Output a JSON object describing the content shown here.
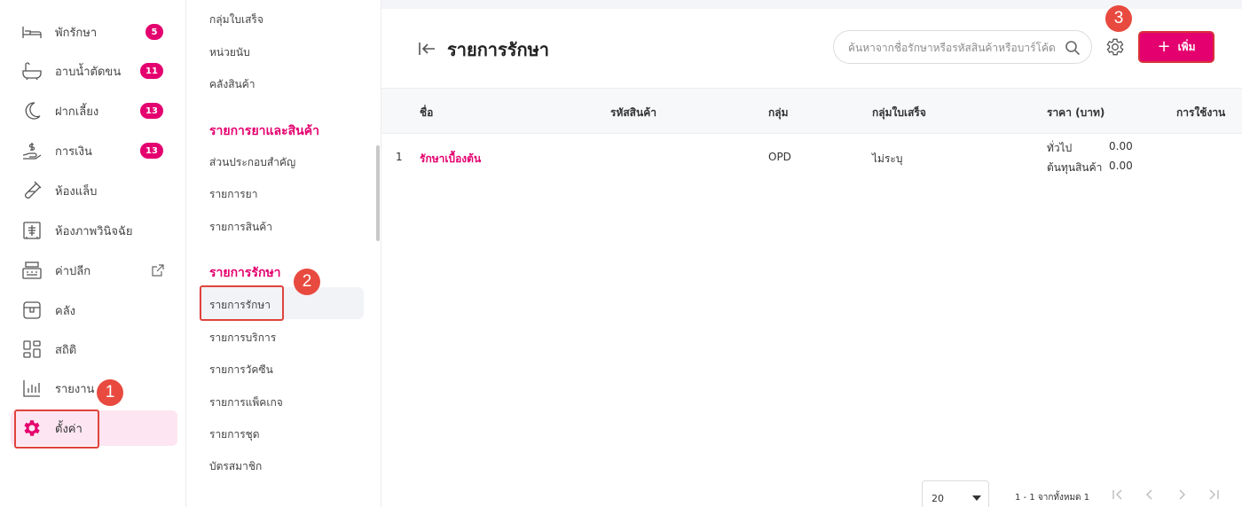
{
  "sidebar": {
    "items": [
      {
        "label": "พักรักษา",
        "badge": "5"
      },
      {
        "label": "อาบน้ำตัดขน",
        "badge": "11"
      },
      {
        "label": "ฝากเลี้ยง",
        "badge": "13"
      },
      {
        "label": "การเงิน",
        "badge": "13"
      },
      {
        "label": "ห้องแล็บ"
      },
      {
        "label": "ห้องภาพวินิจฉัย"
      },
      {
        "label": "ค่าปลีก"
      },
      {
        "label": "คลัง"
      },
      {
        "label": "สถิติ"
      },
      {
        "label": "รายงาน"
      },
      {
        "label": "ตั้งค่า"
      }
    ]
  },
  "submenu": {
    "items_top": [
      "กลุ่มใบเสร็จ",
      "หน่วยนับ",
      "คลังสินค้า"
    ],
    "heading_products": "รายการยาและสินค้า",
    "items_products": [
      "ส่วนประกอบสำคัญ",
      "รายการยา",
      "รายการสินค้า"
    ],
    "heading_treatment": "รายการรักษา",
    "items_treatment": [
      "รายการรักษา",
      "รายการบริการ",
      "รายการวัคซีน",
      "รายการแพ็คเกจ",
      "รายการชุด",
      "บัตรสมาชิก"
    ]
  },
  "main": {
    "title": "รายการรักษา",
    "search_placeholder": "ค้นหาจากชื่อรักษาหรือรหัสสินค้าหรือบาร์โค้ด",
    "add_label": "เพิ่ม",
    "columns": [
      "ชื่อ",
      "รหัสสินค้า",
      "กลุ่ม",
      "กลุ่มใบเสร็จ",
      "ราคา (บาท)",
      "การใช้งาน"
    ],
    "rows": [
      {
        "index": "1",
        "name": "รักษาเบื้องต้น",
        "code": "",
        "group": "OPD",
        "receipt_group": "ไม่ระบุ",
        "price_general_label": "ทั่วไป",
        "price_general": "0.00",
        "price_cost_label": "ต้นทุนสินค้า",
        "price_cost": "0.00"
      }
    ],
    "page_size": "20",
    "page_info": "1 - 1 จากทั้งหมด 1"
  },
  "annotations": {
    "step1": "1",
    "step2": "2",
    "step3": "3"
  },
  "colors": {
    "accent": "#e4006e",
    "annotation": "#e0433c",
    "active_bg": "#fde6f1"
  }
}
